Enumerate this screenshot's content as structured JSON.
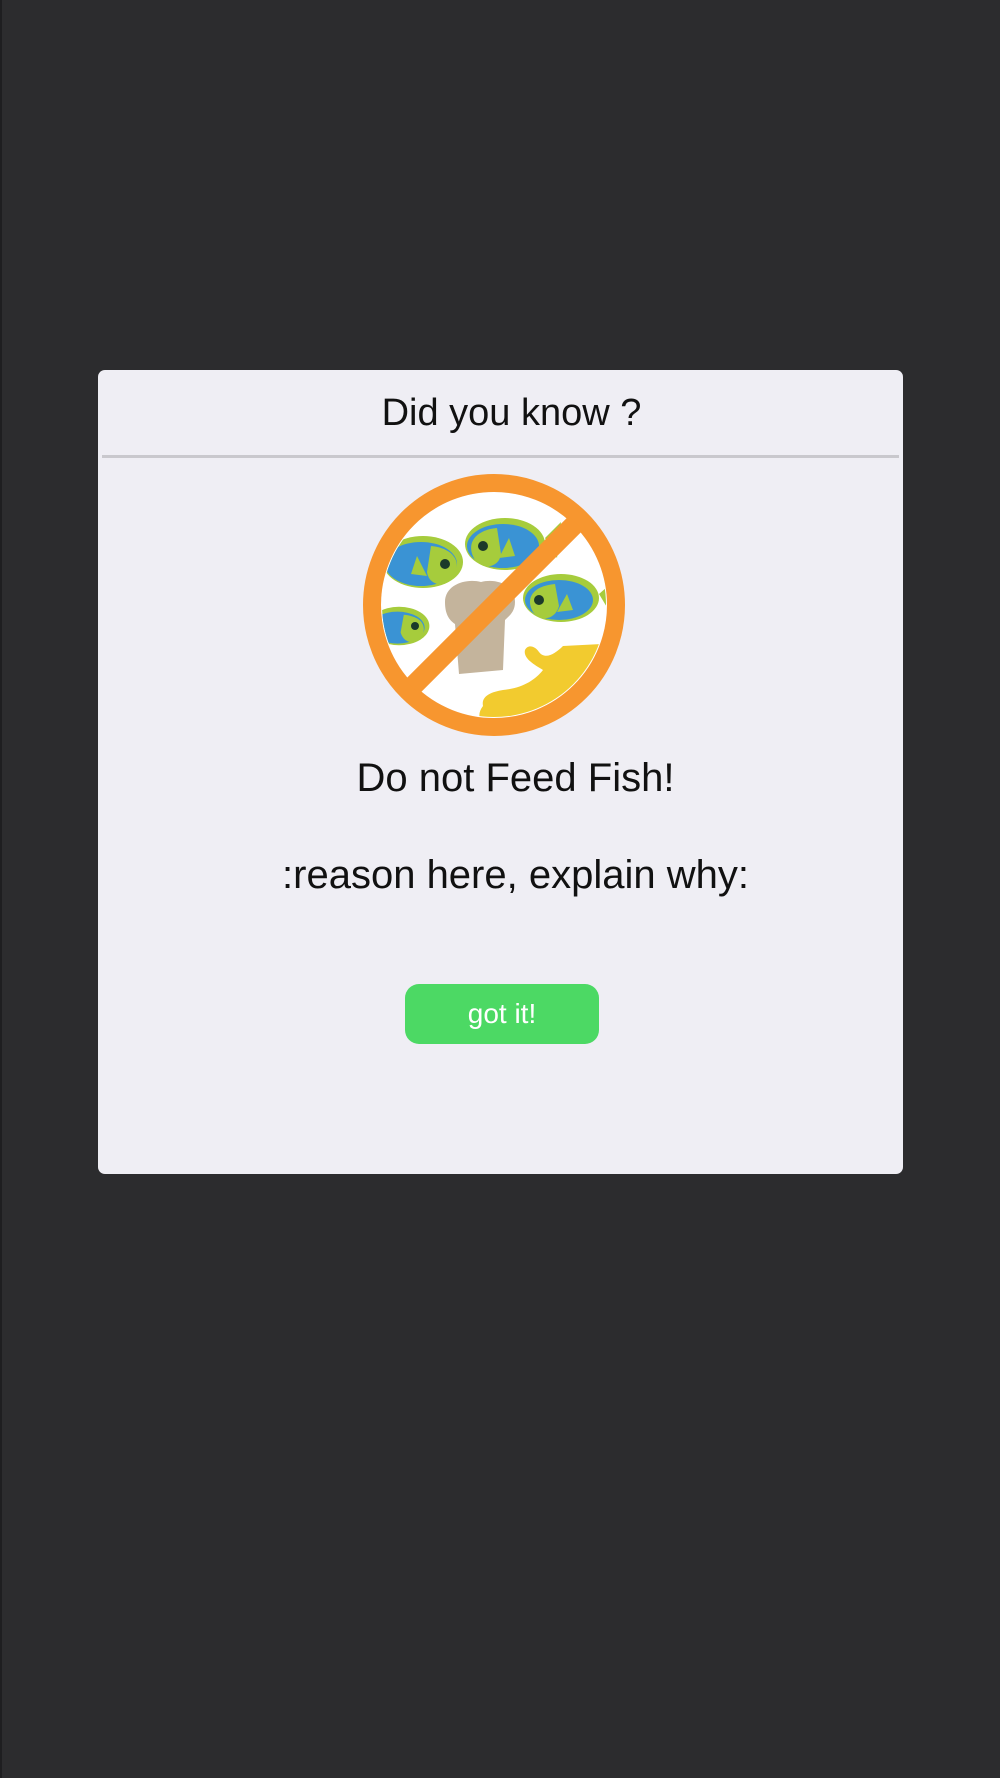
{
  "dialog": {
    "title": "Did you know ?",
    "illustration_icon": "no-feeding-fish-icon",
    "headline": "Do not Feed Fish!",
    "reason": ":reason here, explain why:",
    "button_label": "got it!"
  },
  "colors": {
    "background": "#2c2c2e",
    "dialog_background": "#efeef4",
    "button": "#4cd964",
    "prohibition_ring": "#f7962f",
    "fish_body": "#3a93d4",
    "fish_accent": "#a6cc3c",
    "bread": "#c4b49c",
    "hand": "#f2cb2f"
  }
}
